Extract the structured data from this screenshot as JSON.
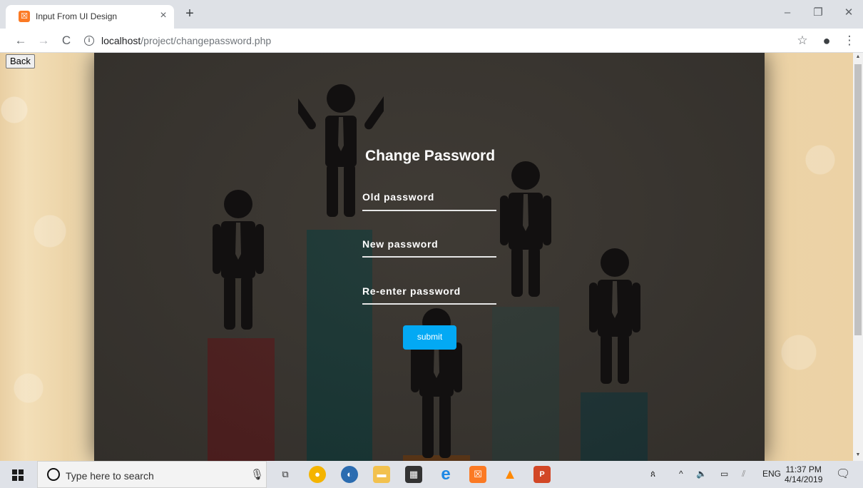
{
  "browser": {
    "tab_title": "Input From UI Design",
    "tab_close": "×",
    "new_tab": "+",
    "favicon": "xampp-icon",
    "url_host": "localhost",
    "url_path": "/project/changepassword.php",
    "window_minimize": "–",
    "window_restore": "❐",
    "window_close": "✕"
  },
  "page": {
    "back_label": "Back",
    "title": "Change Password",
    "fields": [
      {
        "label": "Old password"
      },
      {
        "label": "New password"
      },
      {
        "label": "Re-enter password"
      }
    ],
    "submit_label": "submit",
    "colors": {
      "submit": "#03a9f4",
      "background_frame": "#3b3732",
      "bar_red": "#5a1a1c",
      "bar_teal": "#0f3a3a",
      "bar_gray_teal": "#2c3d3a",
      "bar_dark_teal": "#16363a",
      "bar_orange": "#6a3a10"
    }
  },
  "taskbar": {
    "search_placeholder": "Type here to search",
    "apps": [
      "chrome-icon",
      "edge-dev-icon",
      "file-explorer-icon",
      "store-icon",
      "edge-icon",
      "xampp-icon",
      "vlc-icon",
      "powerpoint-icon"
    ],
    "tray_lang": "ENG",
    "time": "11:37 PM",
    "date": "4/14/2019"
  }
}
